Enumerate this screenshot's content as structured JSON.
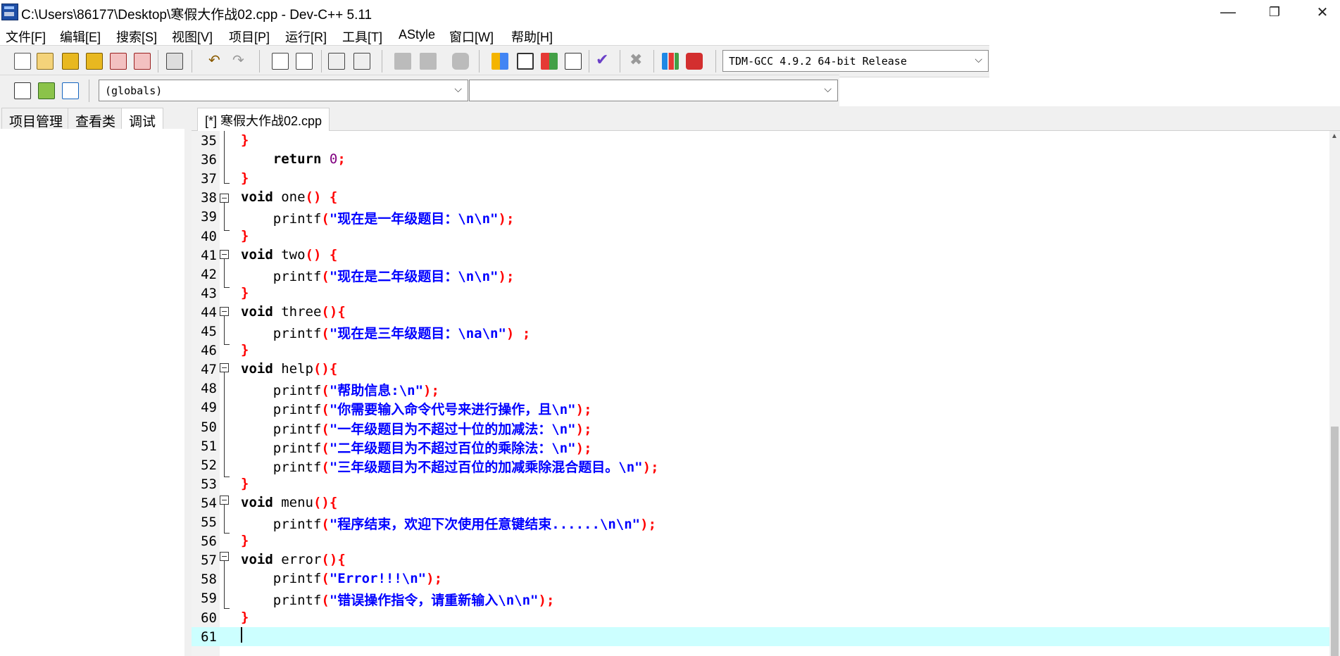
{
  "window": {
    "title": "C:\\Users\\86177\\Desktop\\寒假大作战02.cpp - Dev-C++ 5.11",
    "minimize": "—",
    "restore": "❐",
    "close": "✕"
  },
  "menu": [
    "文件[F]",
    "编辑[E]",
    "搜索[S]",
    "视图[V]",
    "项目[P]",
    "运行[R]",
    "工具[T]",
    "AStyle",
    "窗口[W]",
    "帮助[H]"
  ],
  "toolbar": {
    "compiler": "TDM-GCC 4.9.2 64-bit Release",
    "globals": "(globals)",
    "members": ""
  },
  "left_tabs": [
    "项目管理",
    "查看类",
    "调试"
  ],
  "editor_tab": "[*] 寒假大作战02.cpp",
  "code_lines": [
    {
      "n": "35",
      "text": "}"
    },
    {
      "n": "36",
      "text": "    return 0;"
    },
    {
      "n": "37",
      "text": "}"
    },
    {
      "n": "38",
      "text": "void one() {"
    },
    {
      "n": "39",
      "text": "    printf(\"现在是一年级题目：\\n\\n\");"
    },
    {
      "n": "40",
      "text": "}"
    },
    {
      "n": "41",
      "text": "void two() {"
    },
    {
      "n": "42",
      "text": "    printf(\"现在是二年级题目：\\n\\n\");"
    },
    {
      "n": "43",
      "text": "}"
    },
    {
      "n": "44",
      "text": "void three(){"
    },
    {
      "n": "45",
      "text": "    printf(\"现在是三年级题目：\\na\\n\") ;"
    },
    {
      "n": "46",
      "text": "}"
    },
    {
      "n": "47",
      "text": "void help(){"
    },
    {
      "n": "48",
      "text": "    printf(\"帮助信息:\\n\");"
    },
    {
      "n": "49",
      "text": "    printf(\"你需要输入命令代号来进行操作，且\\n\");"
    },
    {
      "n": "50",
      "text": "    printf(\"一年级题目为不超过十位的加减法：\\n\");"
    },
    {
      "n": "51",
      "text": "    printf(\"二年级题目为不超过百位的乘除法：\\n\");"
    },
    {
      "n": "52",
      "text": "    printf(\"三年级题目为不超过百位的加减乘除混合题目。\\n\");"
    },
    {
      "n": "53",
      "text": "}"
    },
    {
      "n": "54",
      "text": "void menu(){"
    },
    {
      "n": "55",
      "text": "    printf(\"程序结束，欢迎下次使用任意键结束......\\n\\n\");"
    },
    {
      "n": "56",
      "text": "}"
    },
    {
      "n": "57",
      "text": "void error(){"
    },
    {
      "n": "58",
      "text": "    printf(\"Error!!!\\n\");"
    },
    {
      "n": "59",
      "text": "    printf(\"错误操作指令，请重新输入\\n\\n\");"
    },
    {
      "n": "60",
      "text": "}"
    },
    {
      "n": "61",
      "text": ""
    }
  ],
  "colors": {
    "keyword": "#000000",
    "string": "#0000ff",
    "symbol": "#ff0000",
    "number": "#800080",
    "current_line": "#ccffff"
  }
}
